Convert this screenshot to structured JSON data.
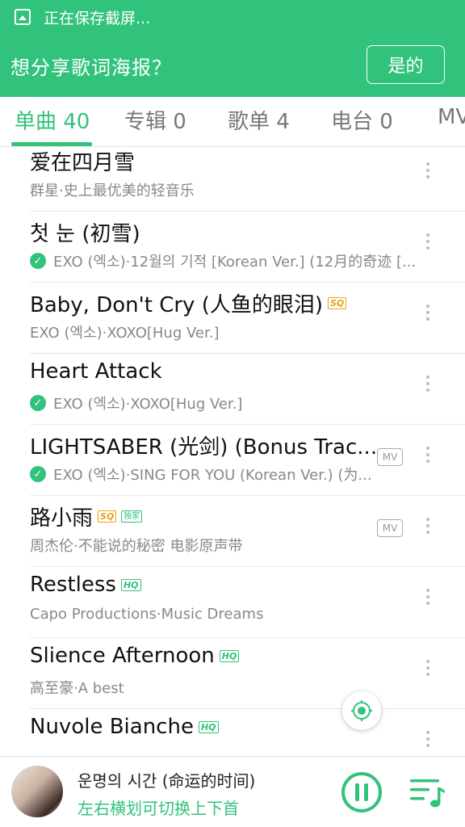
{
  "colors": {
    "accent": "#31c27c",
    "sq_badge": "#e8a317"
  },
  "status_bar": {
    "icon": "image-icon",
    "text": "正在保存截屏..."
  },
  "banner": {
    "text": "想分享歌词海报？",
    "button_label": "是的"
  },
  "tabs": [
    {
      "label": "单曲 40",
      "active": true
    },
    {
      "label": "专辑 0"
    },
    {
      "label": "歌单 4"
    },
    {
      "label": "电台 0"
    },
    {
      "label": "MV"
    }
  ],
  "songs": [
    {
      "title": "爱在四月雪",
      "subtitle": "群星·史上最优美的轻音乐"
    },
    {
      "title": "첫 눈 (初雪)",
      "subtitle": "EXO (엑소)·12월의 기적 [Korean Ver.] (12月的奇迹 [...",
      "downloaded": true
    },
    {
      "title": "Baby, Don't Cry (人鱼的眼泪)",
      "badge": "SQ",
      "subtitle": "EXO (엑소)·XOXO[Hug Ver.]"
    },
    {
      "title": "Heart Attack",
      "subtitle": "EXO (엑소)·XOXO[Hug Ver.]",
      "downloaded": true
    },
    {
      "title": "LIGHTSABER (光剑) (Bonus Trac...",
      "subtitle": "EXO (엑소)·SING FOR YOU (Korean Ver.) (为...",
      "downloaded": true,
      "mv": "MV"
    },
    {
      "title": "路小雨",
      "badge": "SQ",
      "badge2": "独家",
      "subtitle": "周杰伦·不能说的秘密 电影原声带",
      "mv": "MV"
    },
    {
      "title": "Restless",
      "badge": "HQ",
      "subtitle": "Capo Productions·Music Dreams"
    },
    {
      "title": "Slience Afternoon",
      "badge": "HQ",
      "subtitle": "高至豪·A best"
    },
    {
      "title": "Nuvole Bianche",
      "badge": "HQ",
      "subtitle": ""
    }
  ],
  "player": {
    "title": "운명의 시간 (命运的时间)",
    "hint": "左右横划可切换上下首"
  }
}
